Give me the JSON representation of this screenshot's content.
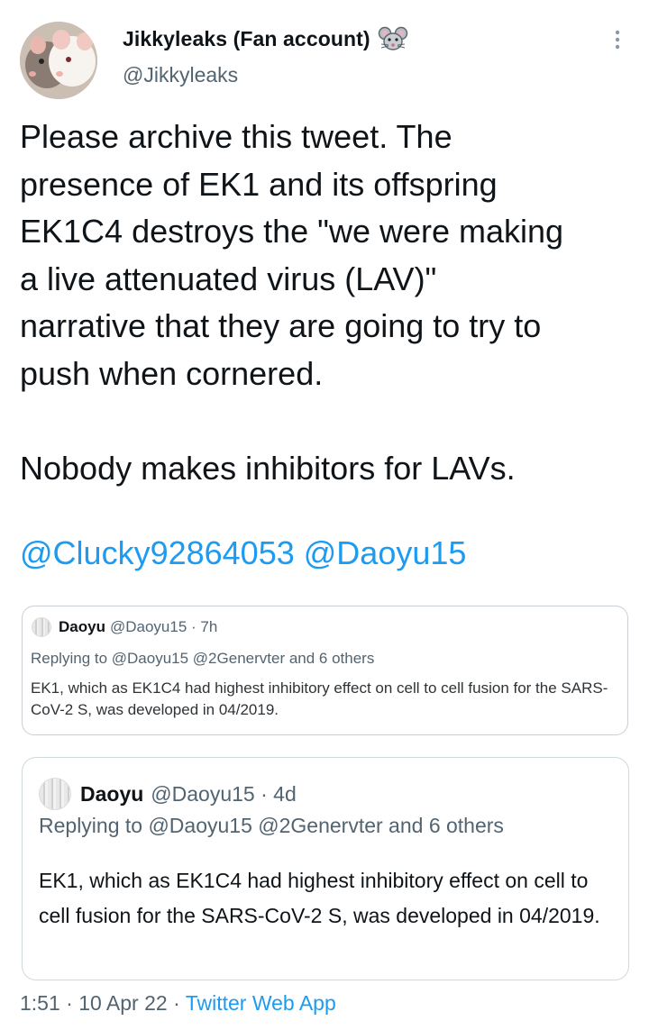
{
  "author": {
    "name": "Jikkyleaks (Fan account)",
    "handle": "@Jikkyleaks",
    "avatar_icon": "rats-photo-avatar",
    "badge_icon": "mouse-emoji-icon"
  },
  "tweet": {
    "text": "Please archive this tweet. The\npresence of EK1 and its offspring\nEK1C4 destroys the \"we were making\na live attenuated virus (LAV)\"\nnarrative that they are going to try to\npush when cornered.\n\nNobody makes inhibitors for LAVs.",
    "mentions": [
      "@Clucky92864053",
      "@Daoyu15"
    ]
  },
  "quoted_screenshot": {
    "name": "Daoyu",
    "meta": "@Daoyu15 · 7h",
    "reply": "Replying to @Daoyu15 @2Genervter and 6 others",
    "body": "EK1, which as EK1C4 had highest inhibitory effect on cell to cell fusion for the SARS-CoV-2 S, was developed in 04/2019."
  },
  "quoted_tweet": {
    "name": "Daoyu",
    "meta": "@Daoyu15 · 4d",
    "reply": "Replying to @Daoyu15 @2Genervter and 6 others",
    "body": "EK1, which as EK1C4 had highest inhibitory effect on cell to cell fusion for the SARS-CoV-2 S, was developed in 04/2019."
  },
  "footer": {
    "time": "1:51 · 10 Apr 22 · ",
    "app": "Twitter Web App"
  },
  "colors": {
    "link": "#1d9bf0",
    "secondary_text": "#536471",
    "primary_text": "#0f1419",
    "border": "#cfd9de"
  }
}
